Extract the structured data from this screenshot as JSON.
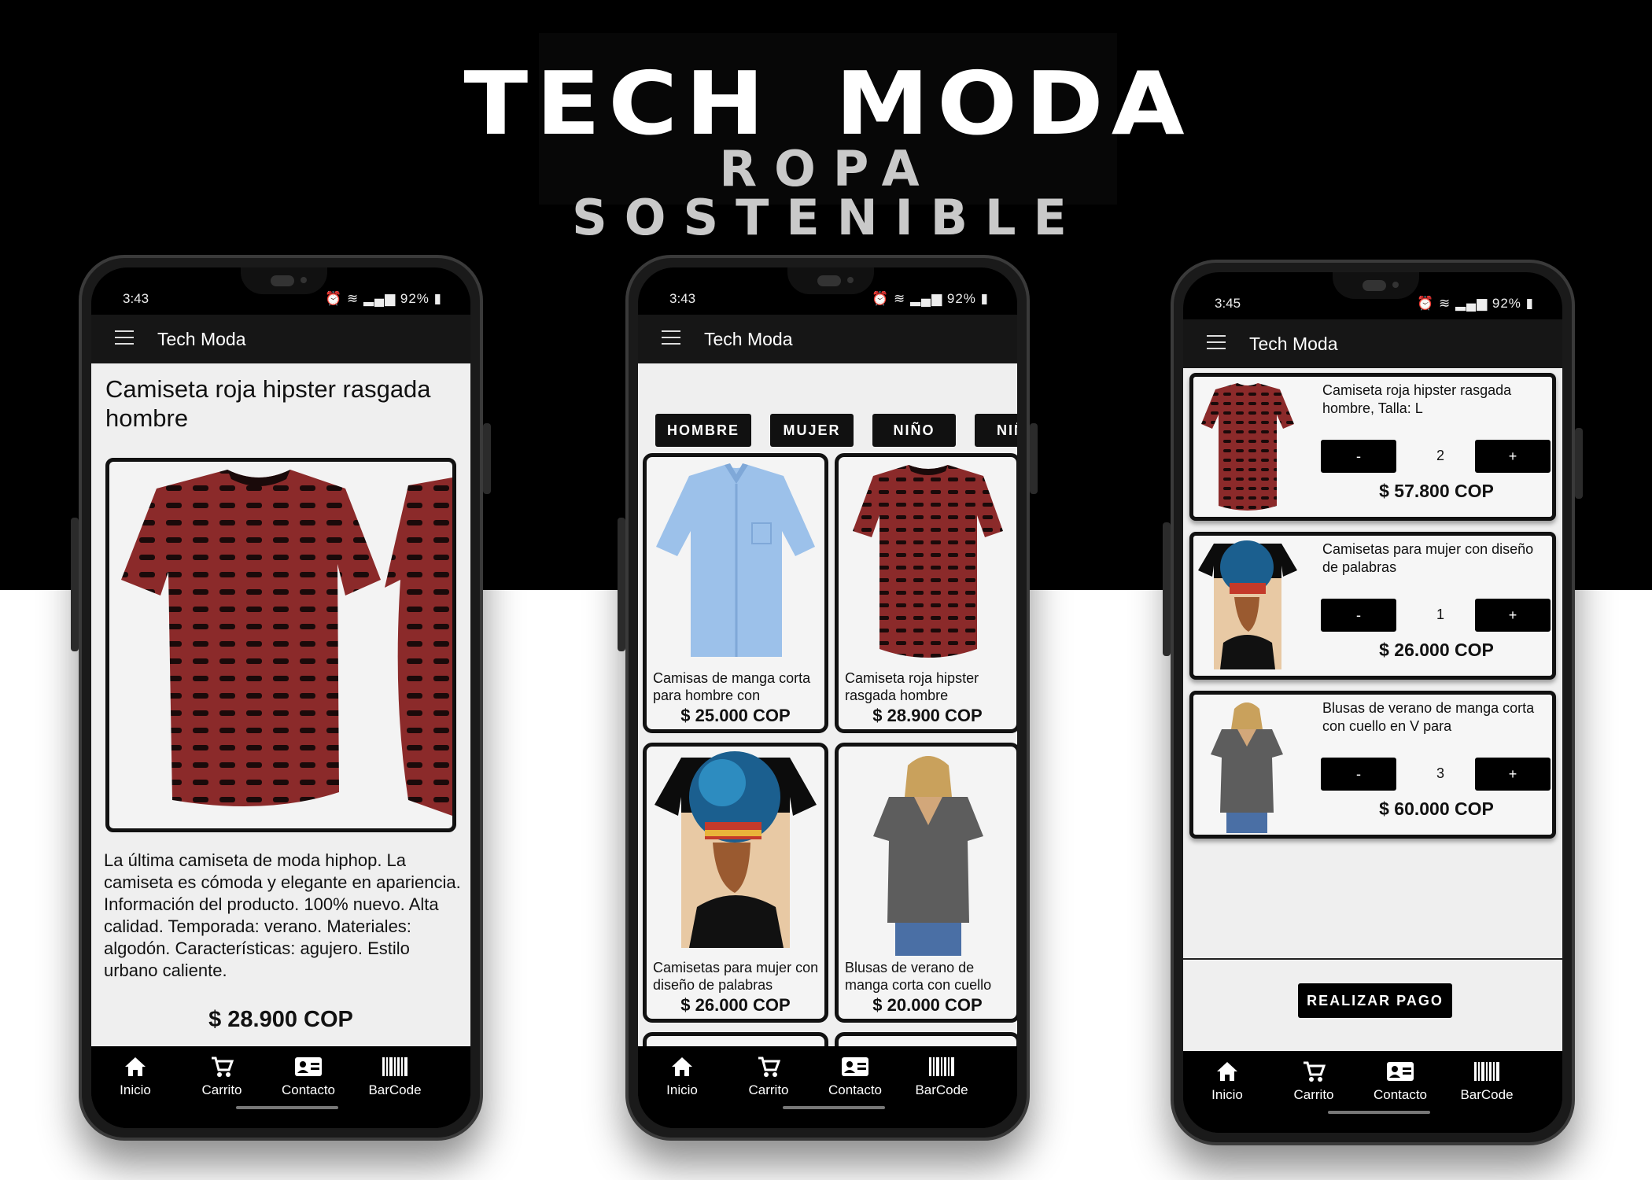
{
  "brand": {
    "name_left": "TECH",
    "name_right": "MODA",
    "tagline": "ROPA SOSTENIBLE",
    "icon": "leaf-icon"
  },
  "colors": {
    "background_top": "#000000",
    "background_bottom": "#ffffff",
    "appbar": "#161616",
    "accent": "#111111",
    "shirt_red": "#8b2a2a",
    "shirt_blue": "#9cc1ea",
    "shirt_grey": "#5d5d5d"
  },
  "nav": {
    "items": [
      {
        "label": "Inicio",
        "icon": "home-icon"
      },
      {
        "label": "Carrito",
        "icon": "cart-icon"
      },
      {
        "label": "Contacto",
        "icon": "contact-card-icon"
      },
      {
        "label": "BarCode",
        "icon": "barcode-icon"
      }
    ]
  },
  "phone1": {
    "status": {
      "time": "3:43",
      "battery": "92%"
    },
    "appbar_title": "Tech Moda",
    "product_title": "Camiseta roja hipster rasgada hombre",
    "description": "La última camiseta de moda hiphop. La camiseta es cómoda y elegante en apariencia. Información del producto. 100% nuevo. Alta calidad. Temporada: verano. Materiales: algodón. Características: agujero. Estilo urbano caliente.",
    "price": "$ 28.900 COP"
  },
  "phone2": {
    "status": {
      "time": "3:43",
      "battery": "92%"
    },
    "appbar_title": "Tech Moda",
    "categories": [
      "HOMBRE",
      "MUJER",
      "NIÑO",
      "NIÑ"
    ],
    "products": [
      {
        "name": "Camisas de manga corta para hombre con",
        "price": "$ 25.000 COP"
      },
      {
        "name": "Camiseta roja hipster rasgada hombre",
        "price": "$ 28.900 COP"
      },
      {
        "name": "Camisetas para mujer con diseño de palabras",
        "price": "$ 26.000 COP"
      },
      {
        "name": "Blusas de verano de manga corta con cuello",
        "price": "$ 20.000 COP"
      }
    ]
  },
  "phone3": {
    "status": {
      "time": "3:45",
      "battery": "92%"
    },
    "appbar_title": "Tech Moda",
    "cart": [
      {
        "name": "Camiseta roja hipster rasgada hombre, Talla: L",
        "qty": "2",
        "minus": "-",
        "plus": "+",
        "price": "$ 57.800 COP"
      },
      {
        "name": "Camisetas para mujer con diseño de palabras",
        "qty": "1",
        "minus": "-",
        "plus": "+",
        "price": "$ 26.000 COP"
      },
      {
        "name": "Blusas de verano de manga corta con cuello en V para",
        "qty": "3",
        "minus": "-",
        "plus": "+",
        "price": "$ 60.000 COP"
      }
    ],
    "pay_label": "REALIZAR PAGO"
  }
}
